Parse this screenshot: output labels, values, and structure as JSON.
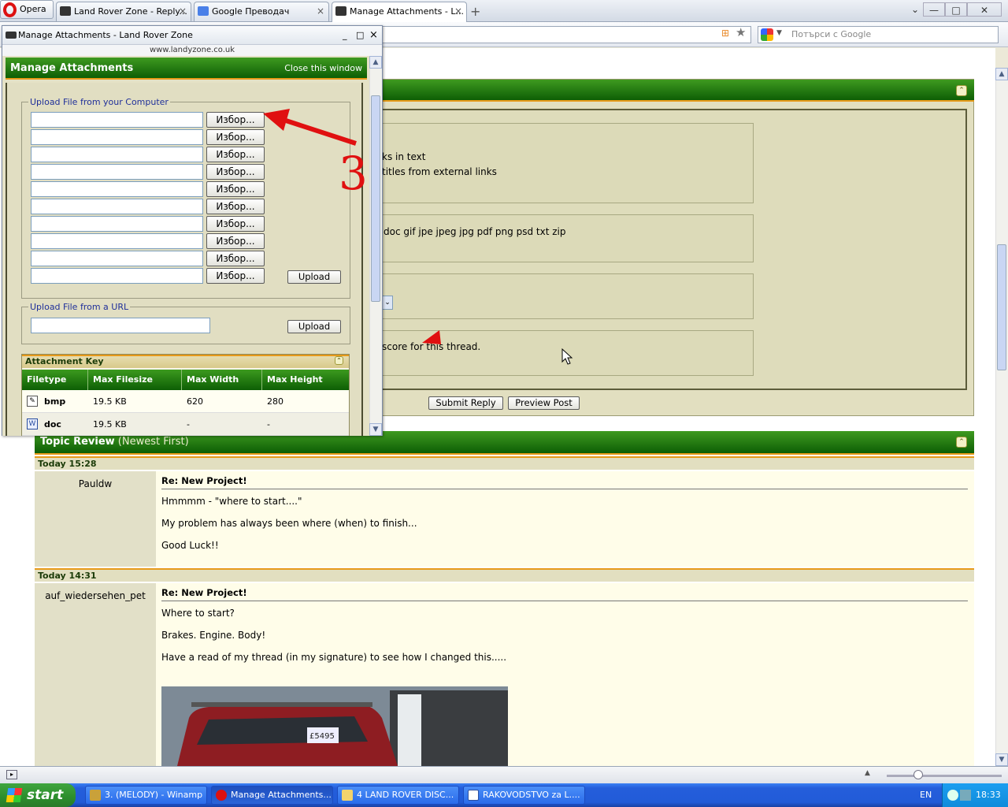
{
  "browser": {
    "menu_label": "Opera",
    "tabs": [
      {
        "label": "Land Rover Zone - Reply...",
        "close": "×"
      },
      {
        "label": "Google Преводач",
        "close": "×"
      },
      {
        "label": "Manage Attachments - L...",
        "close": "×"
      }
    ],
    "new_tab": "+",
    "window_controls": {
      "minimize": "—",
      "maximize": "□",
      "close": "✕",
      "tab_menu": "⌄"
    },
    "search_placeholder": "Потърси с Google"
  },
  "popup": {
    "title": "Manage Attachments - Land Rover Zone",
    "url": "www.landyzone.co.uk",
    "controls": {
      "minimize": "_",
      "maximize": "□",
      "close": "×"
    },
    "heading": "Manage Attachments",
    "close_link": "Close this window",
    "upload_computer": {
      "legend": "Upload File from your Computer",
      "browse_buttons": [
        "Избор...",
        "Избор...",
        "Избор...",
        "Избор...",
        "Избор...",
        "Избор...",
        "Избор...",
        "Избор...",
        "Избор...",
        "Избор..."
      ],
      "upload_button": "Upload"
    },
    "upload_url": {
      "legend": "Upload File from a URL",
      "upload_button": "Upload"
    },
    "attachment_key": {
      "title": "Attachment Key",
      "columns": [
        "Filetype",
        "Max Filesize",
        "Max Width",
        "Max Height"
      ],
      "rows": [
        {
          "type": "bmp",
          "size": "19.5 KB",
          "width": "620",
          "height": "280"
        },
        {
          "type": "doc",
          "size": "19.5 KB",
          "width": "-",
          "height": "-"
        }
      ]
    }
  },
  "annotation": {
    "number": "3",
    "color": "#e01010"
  },
  "page": {
    "options": {
      "line1": "ks in text",
      "line2": "titles from external links",
      "extensions": "doc gif jpe jpeg jpg pdf png psd txt zip",
      "rating": "score for this thread."
    },
    "buttons": {
      "submit": "Submit Reply",
      "preview": "Preview Post"
    },
    "review": {
      "title": "Topic Review",
      "subtitle": "(Newest First)",
      "posts": [
        {
          "date": "Today 15:28",
          "user": "Pauldw",
          "title": "Re: New Project!",
          "lines": [
            "Hmmmm - \"where to start....\"",
            "My problem has always been where (when) to finish...",
            "Good Luck!!"
          ]
        },
        {
          "date": "Today 14:31",
          "user": "auf_wiedersehen_pet",
          "title": "Re: New Project!",
          "lines": [
            "Where to start?",
            "Brakes. Engine. Body!",
            "Have a read of my thread (in my signature) to see how I changed this....."
          ]
        }
      ]
    }
  },
  "taskbar": {
    "start": "start",
    "tasks": [
      {
        "label": "3. (MELODY) - Winamp"
      },
      {
        "label": "Manage Attachments..."
      },
      {
        "label": "4 LAND ROVER DISC..."
      },
      {
        "label": "RAKOVODSTVO za L...."
      }
    ],
    "lang": "EN",
    "clock": "18:33"
  },
  "colors": {
    "header_green": "#0d5e05",
    "accent_orange": "#e79a1a",
    "panel_khaki": "#e2dfc0"
  }
}
